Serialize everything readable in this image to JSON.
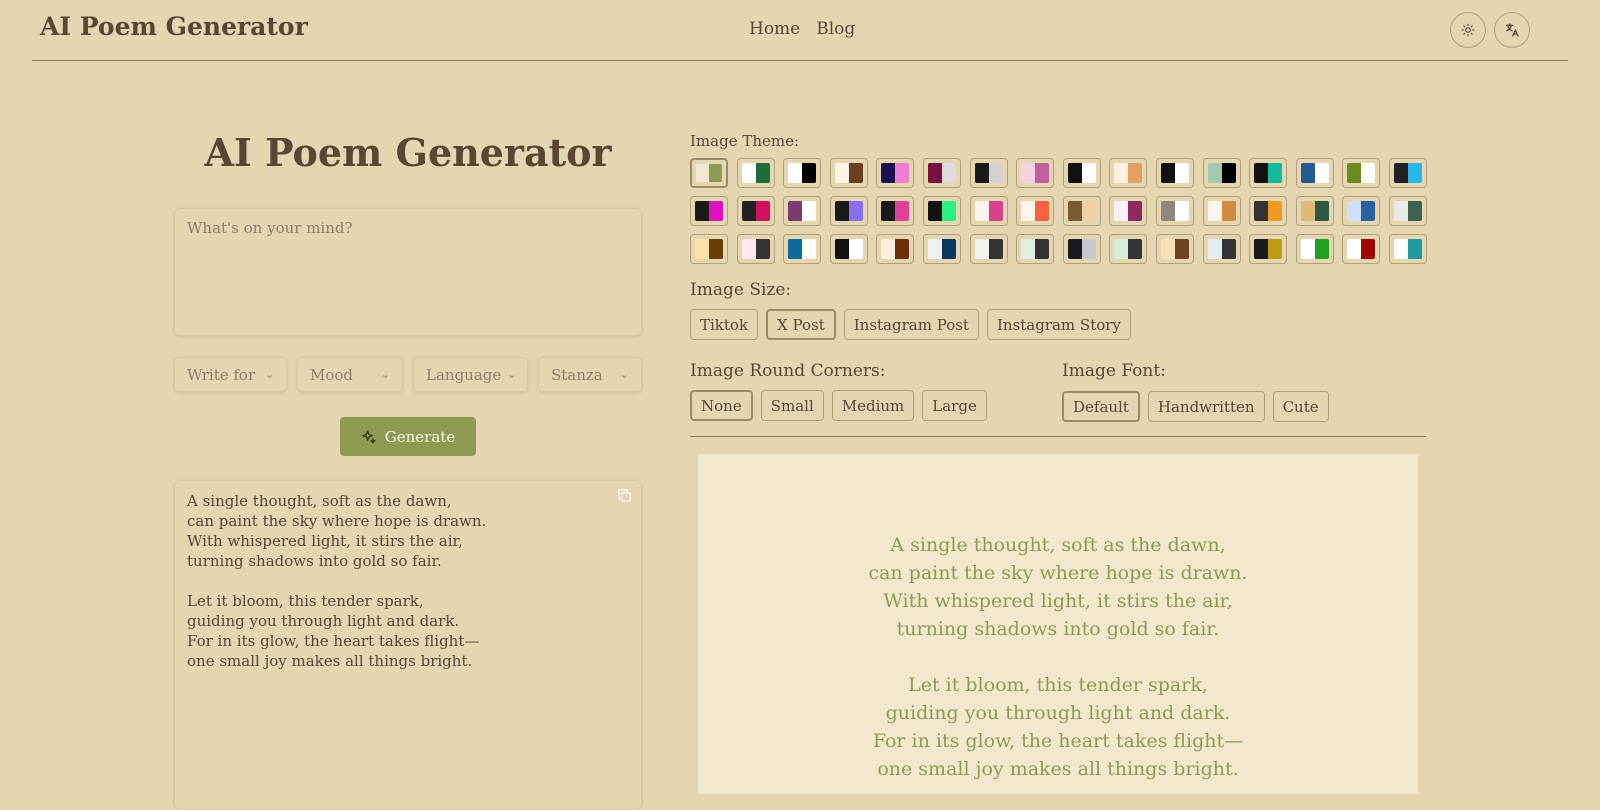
{
  "header": {
    "brand": "AI Poem Generator",
    "nav": [
      "Home",
      "Blog"
    ],
    "theme_icon": "sun-icon",
    "lang_icon": "translate-icon"
  },
  "left": {
    "title": "AI Poem Generator",
    "prompt_placeholder": "What's on your mind?",
    "selects": [
      "Write for",
      "Mood",
      "Language",
      "Stanza"
    ],
    "generate_label": "Generate",
    "generate_icon": "sparkles-icon",
    "copy_icon": "copy-icon"
  },
  "poem": {
    "stanza1": "A single thought, soft as the dawn,\ncan paint the sky where hope is drawn.\nWith whispered light, it stirs the air,\nturning shadows into gold so fair.",
    "stanza2": "Let it bloom, this tender spark,\nguiding you through light and dark.\nFor in its glow, the heart takes flight—\none small joy makes all things bright."
  },
  "image_theme": {
    "label": "Image Theme:",
    "selected_index": 0,
    "swatches": [
      [
        "#f2e8ce",
        "#8c9b51"
      ],
      [
        "#ffffff",
        "#1f6b3a"
      ],
      [
        "#ffffff",
        "#000000"
      ],
      [
        "#fff5e6",
        "#6b3f1f"
      ],
      [
        "#1a1052",
        "#f07ed0"
      ],
      [
        "#7a1042",
        "#dcdcdc"
      ],
      [
        "#1a1a1a",
        "#d8d0d0"
      ],
      [
        "#f5d2e0",
        "#c25fa0"
      ],
      [
        "#111111",
        "#ffffff"
      ],
      [
        "#fff2e0",
        "#e3a060"
      ],
      [
        "#111111",
        "#ffffff"
      ],
      [
        "#a4c8b0",
        "#000000"
      ],
      [
        "#111111",
        "#14b89a"
      ],
      [
        "#245a92",
        "#ffffff"
      ],
      [
        "#6b8a20",
        "#ffffff"
      ],
      [
        "#222222",
        "#29b6e8"
      ],
      [
        "#1a1a1a",
        "#e010c0"
      ],
      [
        "#222222",
        "#d01060"
      ],
      [
        "#7a3a72",
        "#ffffff"
      ],
      [
        "#1a1a1a",
        "#8a6ef0"
      ],
      [
        "#1a1a1a",
        "#e0409a"
      ],
      [
        "#111111",
        "#2cf080"
      ],
      [
        "#fff5ec",
        "#d84090"
      ],
      [
        "#fff5ec",
        "#ff6040"
      ],
      [
        "#7a5a30",
        "#f2d0a8"
      ],
      [
        "#fff0f5",
        "#8e2a60"
      ],
      [
        "#908880",
        "#ffffff"
      ],
      [
        "#fff5ec",
        "#d28a40"
      ],
      [
        "#333333",
        "#f09a20"
      ],
      [
        "#e0b878",
        "#2e5840"
      ],
      [
        "#cfe0f8",
        "#2a62a0"
      ],
      [
        "#e8ece8",
        "#406050"
      ],
      [
        "#ffe0a8",
        "#6b3e08"
      ],
      [
        "#ffe8f0",
        "#333333"
      ],
      [
        "#0e6a9a",
        "#ffffff"
      ],
      [
        "#111111",
        "#ffffff"
      ],
      [
        "#fff0dc",
        "#6b2e08"
      ],
      [
        "#eef2f4",
        "#0e3460"
      ],
      [
        "#f2f2ee",
        "#333333"
      ],
      [
        "#e2ece2",
        "#333333"
      ],
      [
        "#1a1a1a",
        "#c8c8cc"
      ],
      [
        "#d8ecd8",
        "#333333"
      ],
      [
        "#f8e0b8",
        "#6b4522"
      ],
      [
        "#e8ecf0",
        "#333333"
      ],
      [
        "#1a1a1a",
        "#c09a10"
      ],
      [
        "#ffffff",
        "#20a020"
      ],
      [
        "#ffffff",
        "#a00808"
      ],
      [
        "#ffffff",
        "#1f9aa0"
      ]
    ]
  },
  "image_size": {
    "label": "Image Size:",
    "options": [
      "Tiktok",
      "X Post",
      "Instagram Post",
      "Instagram Story"
    ],
    "selected": "X Post"
  },
  "corners": {
    "label": "Image Round Corners:",
    "options": [
      "None",
      "Small",
      "Medium",
      "Large"
    ],
    "selected": "None"
  },
  "font": {
    "label": "Image Font:",
    "options": [
      "Default",
      "Handwritten",
      "Cute"
    ],
    "selected": "Default"
  }
}
